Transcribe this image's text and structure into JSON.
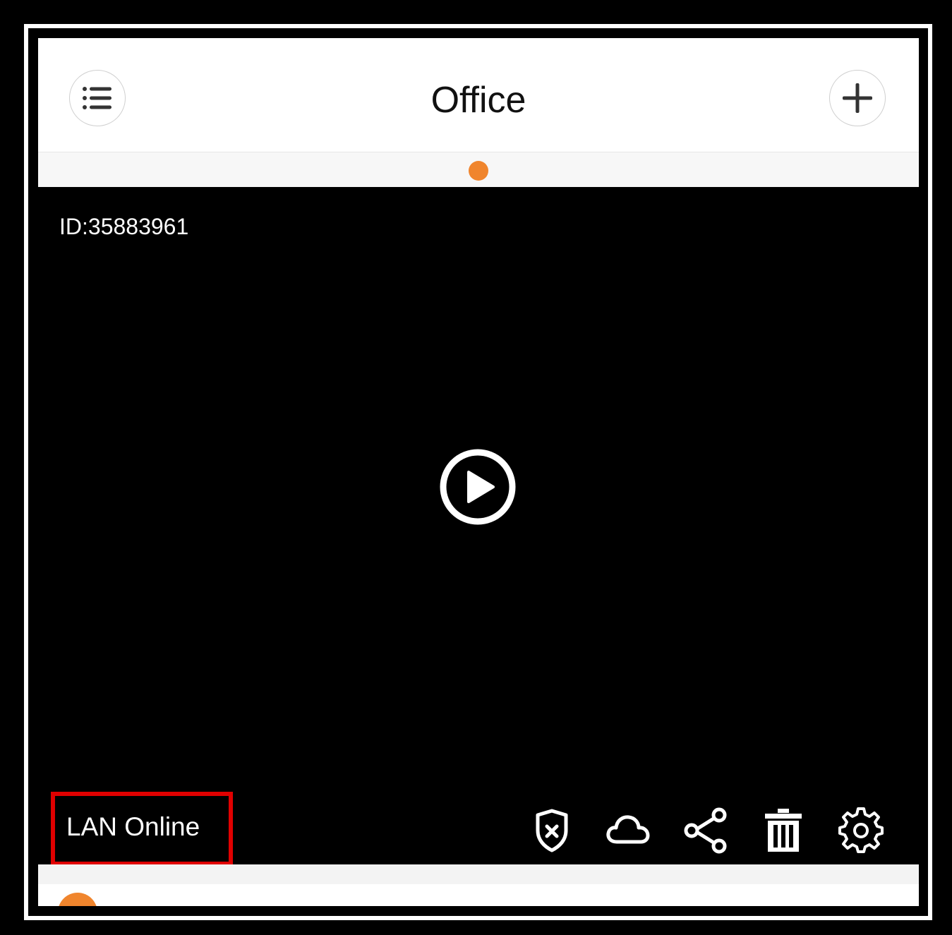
{
  "header": {
    "title": "Office",
    "menu_icon": "list-icon",
    "add_icon": "plus-icon"
  },
  "pager": {
    "active_color": "#f0852d"
  },
  "camera": {
    "device_id": "ID:35883961",
    "status": "LAN Online",
    "play_icon": "play-icon"
  },
  "toolbar": {
    "items": [
      {
        "icon": "shield-x-icon",
        "name": "alarm-disarm"
      },
      {
        "icon": "cloud-icon",
        "name": "cloud-storage"
      },
      {
        "icon": "share-icon",
        "name": "share"
      },
      {
        "icon": "trash-icon",
        "name": "delete"
      },
      {
        "icon": "gear-icon",
        "name": "settings"
      }
    ]
  },
  "colors": {
    "highlight_box": "#e00000",
    "accent": "#f0852d"
  }
}
